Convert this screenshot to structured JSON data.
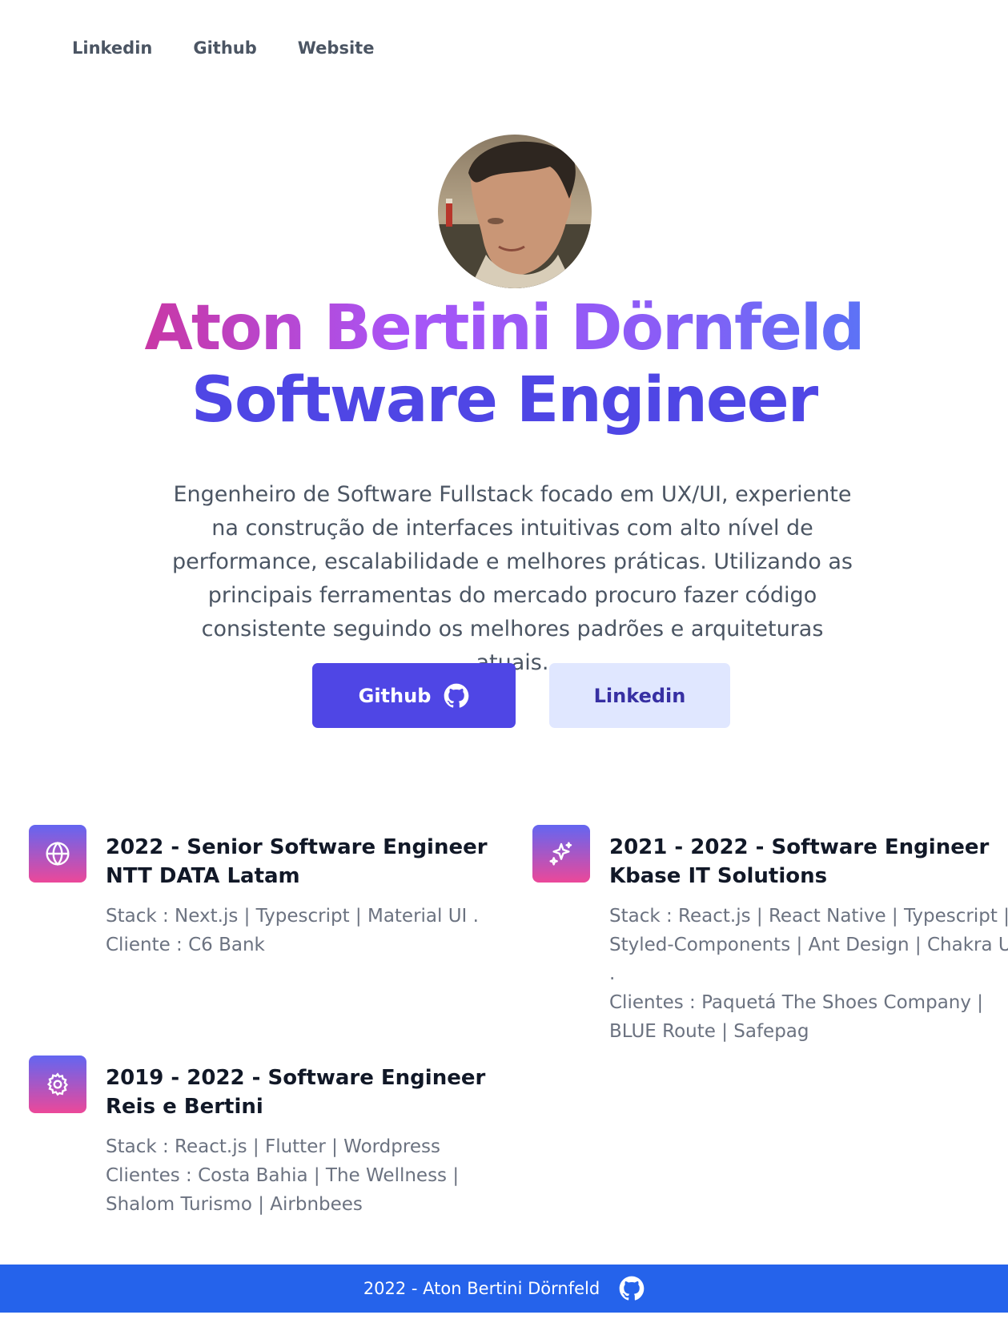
{
  "nav": {
    "items": [
      "Linkedin",
      "Github",
      "Website"
    ]
  },
  "hero": {
    "name": "Aton Bertini Dörnfeld",
    "role": "Software Engineer",
    "bio": "Engenheiro de Software Fullstack focado em UX/UI, experiente na construção de interfaces intuitivas com alto nível de performance, escalabilidade e melhores práticas. Utilizando as principais ferramentas do mercado procuro fazer código consistente seguindo os melhores padrões e arquiteturas atuais.",
    "avatar_icon": "avatar-photo",
    "github_label": "Github",
    "linkedin_label": "Linkedin"
  },
  "experience": [
    {
      "icon": "globe-icon",
      "title_line1": "2022 - Senior Software Engineer",
      "title_line2": "NTT DATA Latam",
      "desc_line1": "Stack : Next.js | Typescript | Material UI .",
      "desc_line2": "Cliente : C6 Bank"
    },
    {
      "icon": "sparkles-icon",
      "title_line1": "2021 - 2022 - Software Engineer",
      "title_line2": "Kbase IT Solutions",
      "desc_line1": "Stack : React.js | React Native | Typescript | Styled-Components | Ant Design | Chakra UI .",
      "desc_line2": "Clientes : Paquetá The Shoes Company | BLUE Route | Safepag"
    },
    {
      "icon": "gear-icon",
      "title_line1": "2019 - 2022 - Software Engineer",
      "title_line2": "Reis e Bertini",
      "desc_line1": "Stack : React.js | Flutter | Wordpress",
      "desc_line2": "Clientes : Costa Bahia | The Wellness | Shalom Turismo | Airbnbees"
    }
  ],
  "footer": {
    "text": "2022 - Aton Bertini Dörnfeld"
  },
  "colors": {
    "primary": "#4f46e5",
    "secondary_bg": "#e0e7ff",
    "footer_bg": "#2563eb",
    "gradient_start": "#db2777",
    "gradient_end": "#3b82f6"
  }
}
